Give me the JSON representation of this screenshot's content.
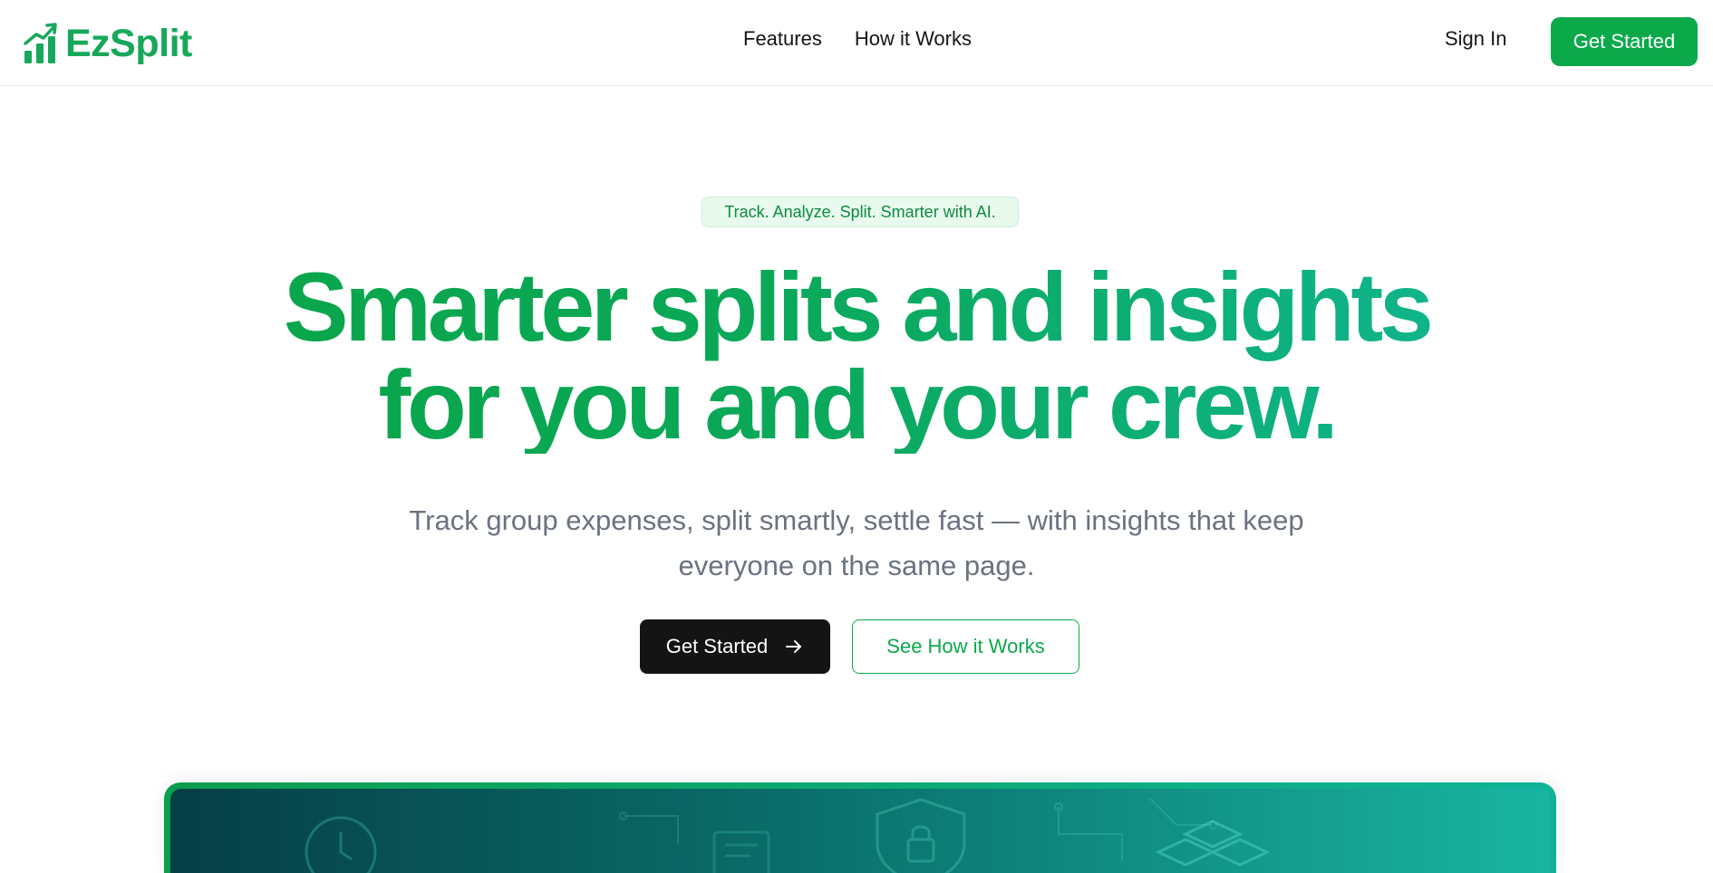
{
  "brand": {
    "name": "EzSplit",
    "color": "#17a85a"
  },
  "nav": {
    "links": [
      "Features",
      "How it Works"
    ],
    "sign_in": "Sign In",
    "cta": "Get Started"
  },
  "hero": {
    "tagline": "Track. Analyze. Split. Smarter with AI.",
    "title_line1": "Smarter splits and insights",
    "title_line2": "for you and your crew.",
    "subtitle_line1": "Track group expenses, split smartly, settle fast — with insights that keep",
    "subtitle_line2": "everyone on the same page.",
    "primary_cta": "Get Started",
    "secondary_cta": "See How it Works"
  },
  "preview": {
    "icons": [
      "clock-icon",
      "document-icon",
      "shield-lock-icon",
      "cubes-icon"
    ]
  },
  "colors": {
    "accent": "#0ba94a",
    "gradient_start": "#0aa544",
    "gradient_end": "#12b9a0",
    "subtitle": "#6b7280",
    "dark_button": "#141414"
  }
}
